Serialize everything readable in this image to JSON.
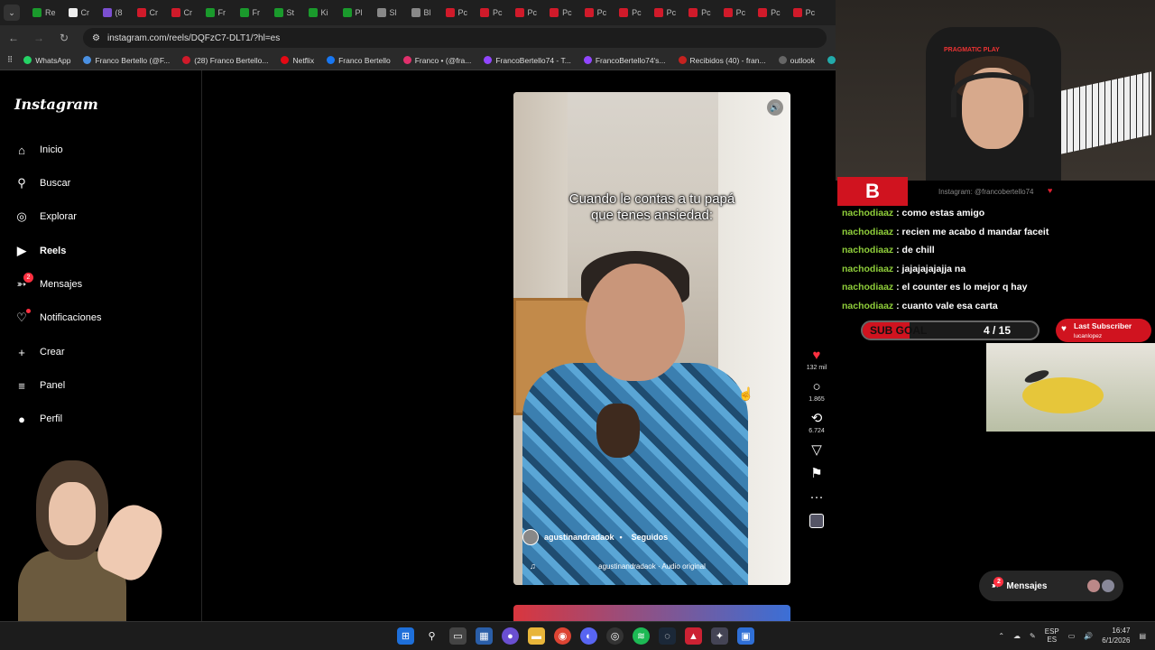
{
  "browser": {
    "tabs": [
      "Re",
      "Cr",
      "(8",
      "Cr",
      "Cr",
      "Fr",
      "Fr",
      "St",
      "Ki",
      "Pl",
      "Sl",
      "Bl",
      "Pc",
      "Pc",
      "Pc",
      "Pc",
      "Pc",
      "Pc",
      "Pc",
      "Pc",
      "Pc",
      "Pc",
      "Pc"
    ],
    "url": "instagram.com/reels/DQFzC7-DLT1/?hl=es",
    "bookmarks": [
      "WhatsApp",
      "Franco Bertello (@F...",
      "(28) Franco Bertello...",
      "Netflix",
      "Franco Bertello",
      "Franco • (@fra...",
      "FrancoBertello74 - T...",
      "FrancoBertello74's...",
      "Recibidos (40) - fran...",
      "outlook",
      "Aler"
    ]
  },
  "instagram": {
    "logo": "Instagram",
    "nav": [
      {
        "label": "Inicio",
        "icon": "⌂"
      },
      {
        "label": "Buscar",
        "icon": "⚲"
      },
      {
        "label": "Explorar",
        "icon": "◎"
      },
      {
        "label": "Reels",
        "icon": "▶"
      },
      {
        "label": "Mensajes",
        "icon": "➳",
        "badge": "2"
      },
      {
        "label": "Notificaciones",
        "icon": "♡"
      },
      {
        "label": "Crear",
        "icon": "+"
      },
      {
        "label": "Panel",
        "icon": "≡"
      },
      {
        "label": "Perfil",
        "icon": "●"
      }
    ],
    "reel": {
      "caption_line1": "Cuando le contas a tu papá",
      "caption_line2": "que tenes ansiedad:",
      "username": "agustinandradaok",
      "separator": "•",
      "follow_state": "Seguidos",
      "audio": "agustinandradaok · Audio original"
    },
    "actions": {
      "likes": "132 mil",
      "comments": "1.865",
      "reposts": "6.724"
    },
    "messages_pill": {
      "label": "Mensajes",
      "badge": "2"
    }
  },
  "stream": {
    "chair_brand": "PRAGMATIC PLAY",
    "logo": "B",
    "instagram_handle": "Instagram: @francobertello74",
    "chat": [
      {
        "user": "nachodiaaz",
        "msg": "como estas amigo"
      },
      {
        "user": "nachodiaaz",
        "msg": "recien me acabo d mandar faceit"
      },
      {
        "user": "nachodiaaz",
        "msg": "de chill"
      },
      {
        "user": "nachodiaaz",
        "msg": "jajajajajajja na"
      },
      {
        "user": "nachodiaaz",
        "msg": "el counter es lo mejor q hay"
      },
      {
        "user": "nachodiaaz",
        "msg": "cuanto vale esa carta"
      }
    ],
    "sub_goal": {
      "label": "SUB GOAL",
      "value": "4 / 15",
      "progress": 0.27
    },
    "last_subscriber": {
      "title": "Last Subscriber",
      "name": "lucanlopez"
    }
  },
  "taskbar": {
    "lang_top": "ESP",
    "lang_bottom": "ES",
    "time": "16:47",
    "date": "6/1/2026"
  },
  "colors": {
    "accent_red": "#d0131f",
    "chat_user": "#8fce3a",
    "like_red": "#ff3040"
  }
}
